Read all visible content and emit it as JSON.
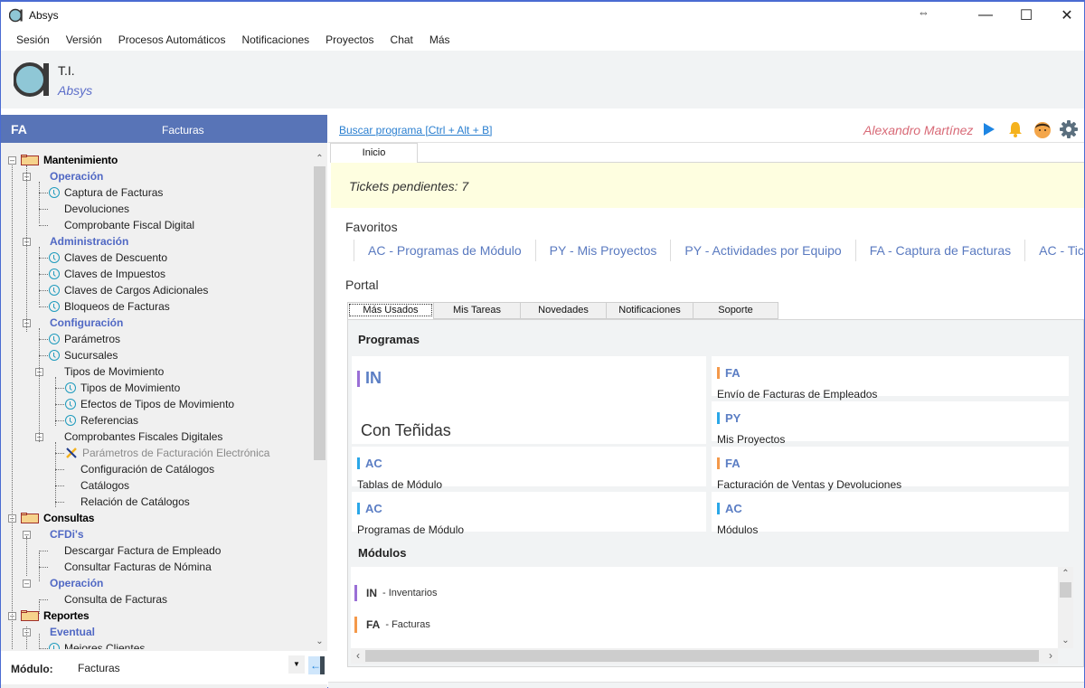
{
  "window": {
    "title": "Absys",
    "resize_glyph": "⇔",
    "controls": {
      "minimize": "—",
      "maximize": "☐",
      "close": "✕"
    }
  },
  "menu": [
    "Sesión",
    "Versión",
    "Procesos Automáticos",
    "Notificaciones",
    "Proyectos",
    "Chat",
    "Más"
  ],
  "header": {
    "org": "T.I.",
    "app": "Absys"
  },
  "module_panel": {
    "code": "FA",
    "name": "Facturas",
    "tree": [
      {
        "label": "Mantenimiento",
        "level": 0,
        "kind": "folder"
      },
      {
        "label": "Operación",
        "level": 1,
        "kind": "category"
      },
      {
        "label": "Captura de Facturas",
        "level": 2,
        "icon": "clock"
      },
      {
        "label": "Devoluciones",
        "level": 2,
        "icon": "none"
      },
      {
        "label": "Comprobante Fiscal Digital",
        "level": 2,
        "icon": "none"
      },
      {
        "label": "Administración",
        "level": 1,
        "kind": "category"
      },
      {
        "label": "Claves de Descuento",
        "level": 2,
        "icon": "clock"
      },
      {
        "label": "Claves de Impuestos",
        "level": 2,
        "icon": "clock"
      },
      {
        "label": "Claves de Cargos Adicionales",
        "level": 2,
        "icon": "clock"
      },
      {
        "label": "Bloqueos de Facturas",
        "level": 2,
        "icon": "clock"
      },
      {
        "label": "Configuración",
        "level": 1,
        "kind": "category"
      },
      {
        "label": "Parámetros",
        "level": 2,
        "icon": "clock"
      },
      {
        "label": "Sucursales",
        "level": 2,
        "icon": "clock"
      },
      {
        "label": "Tipos de Movimiento",
        "level": 2,
        "kind": "group"
      },
      {
        "label": "Tipos de Movimiento",
        "level": 3,
        "icon": "clock"
      },
      {
        "label": "Efectos de Tipos de Movimiento",
        "level": 3,
        "icon": "clock"
      },
      {
        "label": "Referencias",
        "level": 3,
        "icon": "clock"
      },
      {
        "label": "Comprobantes Fiscales Digitales",
        "level": 2,
        "kind": "group"
      },
      {
        "label": "Parámetros de Facturación Electrónica",
        "level": 3,
        "icon": "tools",
        "disabled": true
      },
      {
        "label": "Configuración de Catálogos",
        "level": 3,
        "icon": "none"
      },
      {
        "label": "Catálogos",
        "level": 3,
        "icon": "none"
      },
      {
        "label": "Relación de Catálogos",
        "level": 3,
        "icon": "none"
      },
      {
        "label": "Consultas",
        "level": 0,
        "kind": "folder"
      },
      {
        "label": "CFDi's",
        "level": 1,
        "kind": "category"
      },
      {
        "label": "Descargar Factura de Empleado",
        "level": 2,
        "icon": "none"
      },
      {
        "label": "Consultar Facturas de Nómina",
        "level": 2,
        "icon": "none"
      },
      {
        "label": "Operación",
        "level": 1,
        "kind": "category"
      },
      {
        "label": "Consulta de Facturas",
        "level": 2,
        "icon": "none"
      },
      {
        "label": "Reportes",
        "level": 0,
        "kind": "folder"
      },
      {
        "label": "Eventual",
        "level": 1,
        "kind": "category"
      },
      {
        "label": "Mejores Clientes",
        "level": 2,
        "icon": "clock"
      }
    ],
    "module_label": "Módulo:",
    "module_value": "Facturas"
  },
  "topbar": {
    "search_link": "Buscar programa [Ctrl + Alt + B]",
    "user": "Alexandro Martínez"
  },
  "tabs": {
    "home": "Inicio"
  },
  "tickets": "Tickets pendientes: 7",
  "favorites": {
    "title": "Favoritos",
    "items": [
      "AC - Programas de Módulo",
      "PY - Mis Proyectos",
      "PY - Actividades por Equipo",
      "FA - Captura de Facturas",
      "AC - Tickets"
    ]
  },
  "portal": {
    "title": "Portal",
    "tabs": [
      "Más Usados",
      "Mis Tareas",
      "Novedades",
      "Notificaciones",
      "Soporte"
    ],
    "active_tab": "Más Usados",
    "programs_heading": "Programas",
    "programs": [
      {
        "code": "IN",
        "name": "Con Teñidas",
        "color": "#9a6fd6"
      },
      {
        "code": "FA",
        "name": "Envío de Facturas de Empleados",
        "color": "#f4994a"
      },
      {
        "code": "PY",
        "name": "Mis Proyectos",
        "color": "#2aa7e8"
      },
      {
        "code": "AC",
        "name": "Tablas de Módulo",
        "color": "#2aa7e8"
      },
      {
        "code": "FA",
        "name": "Facturación de Ventas y Devoluciones",
        "color": "#f4994a"
      },
      {
        "code": "AC",
        "name": "Programas de Módulo",
        "color": "#2aa7e8"
      },
      {
        "code": "AC",
        "name": "Módulos",
        "color": "#2aa7e8"
      }
    ],
    "modules_heading": "Módulos",
    "modules": [
      {
        "code": "IN",
        "name": "- Inventarios",
        "color": "#9a6fd6"
      },
      {
        "code": "FA",
        "name": "- Facturas",
        "color": "#f4994a"
      }
    ]
  }
}
